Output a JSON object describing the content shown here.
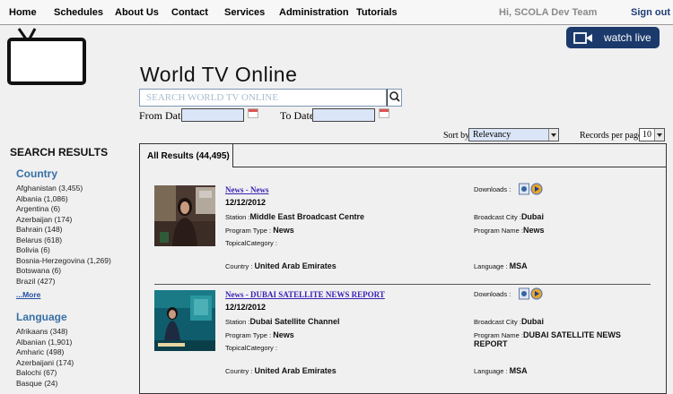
{
  "nav": {
    "items": [
      "Home",
      "Schedules",
      "About Us",
      "Contact",
      "Services",
      "Administration",
      "Tutorials"
    ],
    "greeting": "Hi, SCOLA Dev Team",
    "signout": "Sign out"
  },
  "watch_live": "watch live",
  "page_title": "World TV Online",
  "search": {
    "placeholder": "SEARCH WORLD TV ONLINE",
    "value": ""
  },
  "dates": {
    "from_label": "From Date",
    "to_label": "To Date"
  },
  "sort": {
    "label": "Sort by",
    "value": "Relevancy",
    "rpp_label": "Records per page",
    "rpp_value": "10"
  },
  "sidebar": {
    "heading": "SEARCH RESULTS",
    "country_title": "Country",
    "countries": [
      "Afghanistan (3,455)",
      "Albania (1,086)",
      "Argentina (6)",
      "Azerbaijan (174)",
      "Bahrain (148)",
      "Belarus (618)",
      "Bolivia (6)",
      "Bosnia-Herzegovina (1,269)",
      "Botswana (6)",
      "Brazil (427)"
    ],
    "more": "...More",
    "language_title": "Language",
    "languages": [
      "Afrikaans (348)",
      "Albanian (1,901)",
      "Amharic (498)",
      "Azerbaijani (174)",
      "Balochi (67)",
      "Basque (24)"
    ]
  },
  "tab": "All Results (44,495)",
  "results": [
    {
      "title": "News - News",
      "date": "12/12/2012",
      "station_label": "Station :",
      "station": "Middle East Broadcast Centre",
      "program_type_label": "Program Type :",
      "program_type": "News",
      "topical_label": "TopicalCategory :",
      "country_label": "Country :",
      "country": "United Arab Emirates",
      "downloads_label": "Downloads :",
      "city_label": "Broadcast City :",
      "city": "Dubai",
      "program_name_label": "Program Name :",
      "program_name": "News",
      "language_label": "Language :",
      "language": "MSA"
    },
    {
      "title": "News - DUBAI SATELLITE NEWS REPORT",
      "date": "12/12/2012",
      "station_label": "Station :",
      "station": "Dubai Satellite Channel",
      "program_type_label": "Program Type :",
      "program_type": "News",
      "topical_label": "TopicalCategory :",
      "country_label": "Country :",
      "country": "United Arab Emirates",
      "downloads_label": "Downloads :",
      "city_label": "Broadcast City :",
      "city": "Dubai",
      "program_name_label": "Program Name :",
      "program_name": "DUBAI SATELLITE NEWS REPORT",
      "language_label": "Language :",
      "language": "MSA"
    }
  ],
  "colors": {
    "nav_border": "#9a9a9a",
    "watch_live_bg": "#1b3a6b",
    "facet_title": "#3770a5",
    "result_link": "#3a1fb5",
    "date_input_bg": "#dbe5f8"
  }
}
